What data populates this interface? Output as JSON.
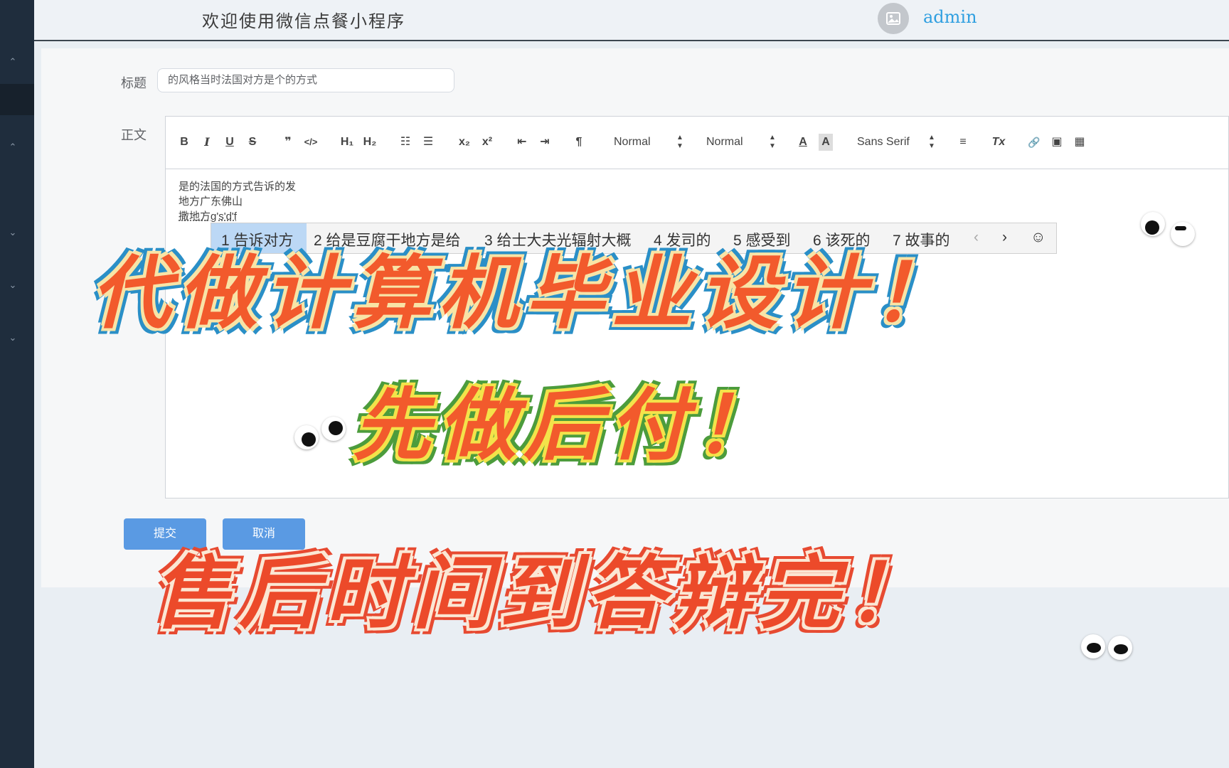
{
  "header": {
    "welcome": "欢迎使用微信点餐小程序",
    "user": "admin"
  },
  "sidebar": {
    "chevrons": [
      "⌃",
      "⌃",
      "⌄",
      "⌄",
      "⌄"
    ]
  },
  "form": {
    "title_label": "标题",
    "title_value": "的风格当时法国对方是个的方式",
    "body_label": "正文",
    "submit_label": "提交",
    "cancel_label": "取消"
  },
  "editor": {
    "toolbar": {
      "bold": "B",
      "italic": "I",
      "underline": "U",
      "strike": "S",
      "quote": "❞",
      "code": "</>",
      "h1": "H₁",
      "h2": "H₂",
      "ol": "☷",
      "ul": "☰",
      "sub": "x₂",
      "sup": "x²",
      "outdent": "⇤",
      "indent": "⇥",
      "direction": "¶",
      "size_picker": "Normal",
      "header_picker": "Normal",
      "color": "A",
      "bg": "A",
      "font_picker": "Sans Serif",
      "align": "≡",
      "clean": "Tx",
      "link": "🔗",
      "image": "▣",
      "video": "▦"
    },
    "lines": [
      "是的法国的方式告诉的发",
      "地方广东佛山",
      "撒地方g's'd'f"
    ]
  },
  "ime": {
    "candidates": [
      "1 告诉对方",
      "2 给是豆腐干地方是给",
      "3 给士大夫光辐射大概",
      "4 发司的",
      "5 感受到",
      "6 该死的",
      "7 故事的"
    ],
    "prev": "‹",
    "next": "›",
    "emoji": "☺"
  },
  "banners": {
    "line1": "代做计算机毕业设计！",
    "line2": "先做后付！",
    "line3": "售后时间到答辩完！"
  }
}
